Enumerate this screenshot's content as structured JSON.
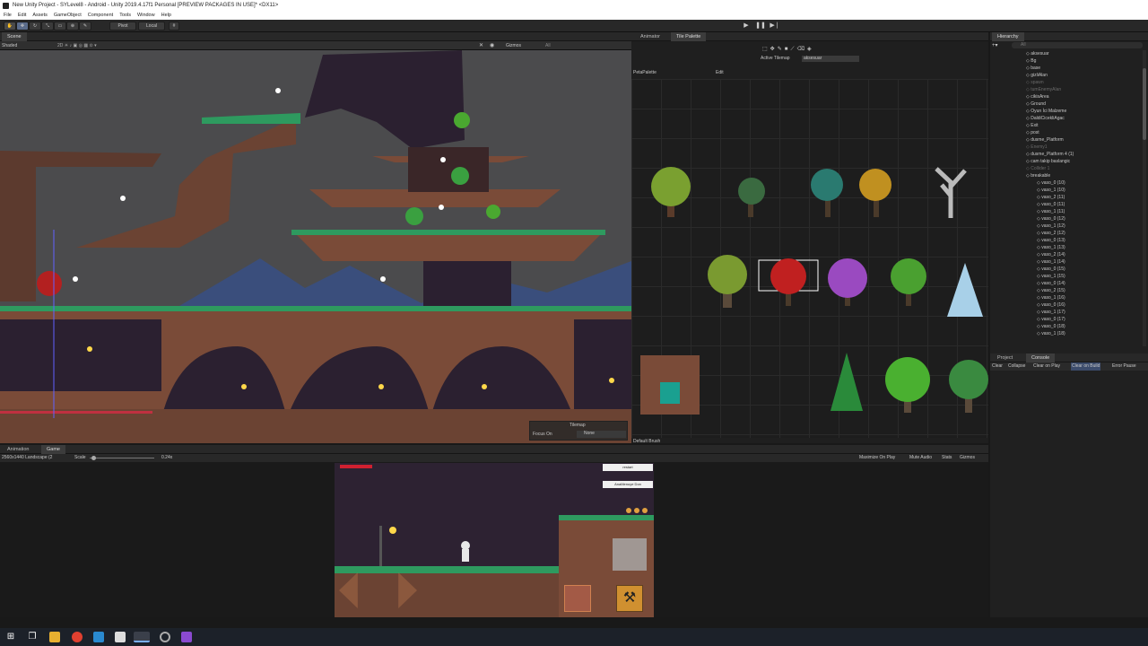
{
  "window": {
    "title": "New Unity Project - SYLevel8 - Android - Unity 2019.4.17f1 Personal [PREVIEW PACKAGES IN USE]* <DX11>"
  },
  "menu": [
    "File",
    "Edit",
    "Assets",
    "GameObject",
    "Component",
    "Tools",
    "Window",
    "Help"
  ],
  "toolbar": {
    "pivot": "Pivot",
    "local": "Local"
  },
  "scene": {
    "tab": "Scene",
    "shading": "Shaded",
    "gizmos": "Gizmos",
    "all": "All",
    "tilemap_label": "Tilemap",
    "focus_on": "Focus On",
    "focus_value": "None"
  },
  "palette": {
    "tabs": [
      "Animator",
      "Tile Palette"
    ],
    "active_tilemap_label": "Active Tilemap",
    "active_tilemap_value": "aksesuar",
    "palette_name": "PetaPalette",
    "edit_label": "Edit",
    "default_brush": "Default Brush"
  },
  "hierarchy": {
    "tab": "Hierarchy",
    "search": "All",
    "rows": [
      {
        "label": "aksesuar",
        "depth": 1,
        "dim": false,
        "icon": "cube"
      },
      {
        "label": "Bg",
        "depth": 1,
        "dim": false,
        "icon": "cube"
      },
      {
        "label": "base",
        "depth": 1,
        "dim": false,
        "icon": "cube"
      },
      {
        "label": "gizliAlan",
        "depth": 1,
        "dim": false,
        "icon": "cube"
      },
      {
        "label": "spawn",
        "depth": 1,
        "dim": true,
        "icon": "cube"
      },
      {
        "label": "tumEnemyAlan",
        "depth": 1,
        "dim": true,
        "icon": "cube"
      },
      {
        "label": "cikisArea",
        "depth": 1,
        "dim": false,
        "icon": "cube"
      },
      {
        "label": "Ground",
        "depth": 1,
        "dim": false,
        "icon": "cube"
      },
      {
        "label": "Oyun İci Malzeme",
        "depth": 1,
        "dim": false,
        "icon": "cube"
      },
      {
        "label": "DaldiCicekliAgac",
        "depth": 1,
        "dim": false,
        "icon": "cube"
      },
      {
        "label": "Exit",
        "depth": 1,
        "dim": false,
        "icon": "cube"
      },
      {
        "label": "post",
        "depth": 1,
        "dim": false,
        "icon": "cube"
      },
      {
        "label": "dusme_Platform",
        "depth": 1,
        "dim": false,
        "icon": "cube"
      },
      {
        "label": "Enemy1",
        "depth": 1,
        "dim": true,
        "icon": "cube"
      },
      {
        "label": "dusme_Platform 4 (1)",
        "depth": 1,
        "dim": false,
        "icon": "cube"
      },
      {
        "label": "cam takip baslangic",
        "depth": 1,
        "dim": false,
        "icon": "cube"
      },
      {
        "label": "Collider 1",
        "depth": 1,
        "dim": true,
        "icon": "cube"
      },
      {
        "label": "breakable",
        "depth": 1,
        "dim": false,
        "icon": "cube"
      },
      {
        "label": "vaso_0 (10)",
        "depth": 2,
        "dim": false,
        "icon": "cube"
      },
      {
        "label": "vaso_1 (10)",
        "depth": 2,
        "dim": false,
        "icon": "cube"
      },
      {
        "label": "vaso_2 (11)",
        "depth": 2,
        "dim": false,
        "icon": "cube"
      },
      {
        "label": "vaso_0 (11)",
        "depth": 2,
        "dim": false,
        "icon": "cube"
      },
      {
        "label": "vaso_1 (11)",
        "depth": 2,
        "dim": false,
        "icon": "cube"
      },
      {
        "label": "vaso_0 (12)",
        "depth": 2,
        "dim": false,
        "icon": "cube"
      },
      {
        "label": "vaso_1 (12)",
        "depth": 2,
        "dim": false,
        "icon": "cube"
      },
      {
        "label": "vaso_2 (12)",
        "depth": 2,
        "dim": false,
        "icon": "cube"
      },
      {
        "label": "vaso_0 (13)",
        "depth": 2,
        "dim": false,
        "icon": "cube"
      },
      {
        "label": "vaso_1 (13)",
        "depth": 2,
        "dim": false,
        "icon": "cube"
      },
      {
        "label": "vaso_2 (14)",
        "depth": 2,
        "dim": false,
        "icon": "cube"
      },
      {
        "label": "vaso_1 (14)",
        "depth": 2,
        "dim": false,
        "icon": "cube"
      },
      {
        "label": "vaso_0 (15)",
        "depth": 2,
        "dim": false,
        "icon": "cube"
      },
      {
        "label": "vaso_1 (15)",
        "depth": 2,
        "dim": false,
        "icon": "cube"
      },
      {
        "label": "vaso_0 (14)",
        "depth": 2,
        "dim": false,
        "icon": "cube"
      },
      {
        "label": "vaso_2 (15)",
        "depth": 2,
        "dim": false,
        "icon": "cube"
      },
      {
        "label": "vaso_1 (16)",
        "depth": 2,
        "dim": false,
        "icon": "cube"
      },
      {
        "label": "vaso_0 (16)",
        "depth": 2,
        "dim": false,
        "icon": "cube"
      },
      {
        "label": "vaso_1 (17)",
        "depth": 2,
        "dim": false,
        "icon": "cube"
      },
      {
        "label": "vaso_0 (17)",
        "depth": 2,
        "dim": false,
        "icon": "cube"
      },
      {
        "label": "vaso_0 (18)",
        "depth": 2,
        "dim": false,
        "icon": "cube"
      },
      {
        "label": "vaso_1 (18)",
        "depth": 2,
        "dim": false,
        "icon": "cube"
      }
    ]
  },
  "project": {
    "tabs": [
      "Project",
      "Console"
    ],
    "buttons": [
      "Clear",
      "Collapse",
      "Clear on Play",
      "Clear on Build",
      "Error Pause"
    ]
  },
  "game": {
    "tabs": [
      "Animation",
      "Game"
    ],
    "resolution": "2560x1440 Landscape (2",
    "scale_label": "Scale",
    "scale_value": "0.24x",
    "right_buttons": [
      "Maximize On Play",
      "Mute Audio",
      "Stats",
      "Gizmos"
    ],
    "ui_buttons": [
      "restart",
      "AnaMenuye Don"
    ]
  },
  "colors": {
    "accent": "#2d5c9a",
    "panel": "#282828",
    "grass": "#2e9a5f",
    "wood": "#7a4b38"
  }
}
